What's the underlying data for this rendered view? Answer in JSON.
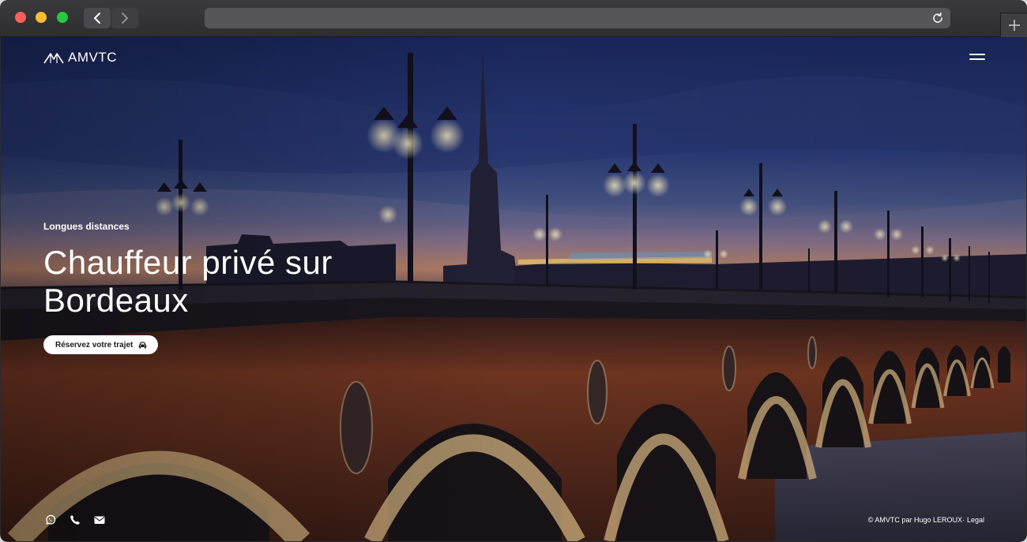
{
  "browser": {
    "url": ""
  },
  "site": {
    "logo_text": "AMVTC"
  },
  "hero": {
    "eyebrow": "Longues distances",
    "title": "Chauffeur privé sur Bordeaux",
    "cta_label": "Réservez votre trajet"
  },
  "footer": {
    "copyright": "© AMVTC par Hugo LEROUX·",
    "legal_link": "Legal"
  },
  "icons": {
    "social": [
      "whatsapp-icon",
      "phone-icon",
      "envelope-icon"
    ],
    "cta": "car-icon"
  },
  "colors": {
    "sky_top": "#1f2a5e",
    "sky_horizon": "#c98a6a",
    "bridge_brick": "#6e3422",
    "lamp_glow": "#fff4cc"
  }
}
